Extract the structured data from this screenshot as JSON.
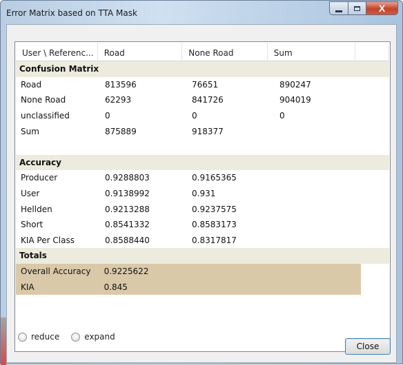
{
  "window": {
    "title": "Error Matrix based on TTA Mask",
    "close_glyph": "X",
    "minimize_icon": "minimize-icon",
    "maximize_icon": "maximize-icon"
  },
  "table": {
    "columns": [
      "User \\ Referenc...",
      "Road",
      "None Road",
      "Sum"
    ],
    "sections": [
      {
        "title": "Confusion Matrix",
        "rows": [
          [
            "Road",
            "813596",
            "76651",
            "890247"
          ],
          [
            "None Road",
            "62293",
            "841726",
            "904019"
          ],
          [
            "unclassified",
            "0",
            "0",
            "0"
          ],
          [
            "Sum",
            "875889",
            "918377",
            ""
          ]
        ]
      },
      {
        "title": "Accuracy",
        "rows": [
          [
            "Producer",
            "0.9288803",
            "0.9165365",
            ""
          ],
          [
            "User",
            "0.9138992",
            "0.931",
            ""
          ],
          [
            "Hellden",
            "0.9213288",
            "0.9237575",
            ""
          ],
          [
            "Short",
            "0.8541332",
            "0.8583173",
            ""
          ],
          [
            "KIA Per Class",
            "0.8588440",
            "0.8317817",
            ""
          ]
        ]
      },
      {
        "title": "Totals",
        "rows": [
          [
            "Overall Accuracy",
            "0.9225622",
            "",
            ""
          ],
          [
            "KIA",
            "0.845",
            "",
            ""
          ]
        ]
      }
    ]
  },
  "footer": {
    "reduce_label": "reduce",
    "expand_label": "expand",
    "close_label": "Close"
  },
  "colors": {
    "section_bg": "#ecebde",
    "totals_bg": "#d9c9a9",
    "close_button": "#c3432a"
  }
}
